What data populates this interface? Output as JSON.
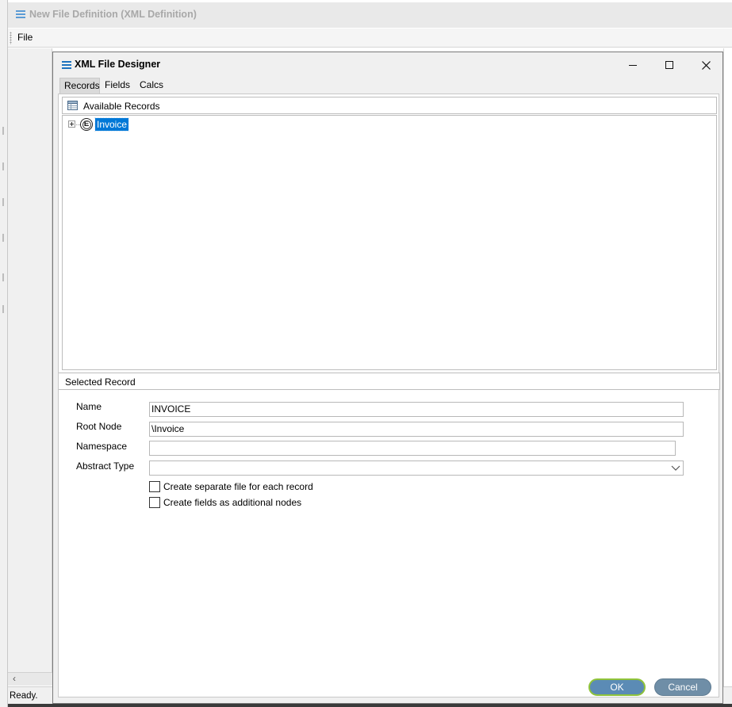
{
  "parent": {
    "title": "New File Definition (XML Definition)",
    "menu": {
      "file": "File"
    },
    "status": "Ready."
  },
  "dialog": {
    "title": "XML File Designer",
    "tabs": [
      {
        "label": "Records",
        "active": true
      },
      {
        "label": "Fields",
        "active": false
      },
      {
        "label": "Calcs",
        "active": false
      }
    ],
    "available_records": {
      "header": "Available Records",
      "items": [
        {
          "icon": "element-icon",
          "glyph": "E",
          "label": "Invoice",
          "selected": true
        }
      ]
    },
    "selected_record": {
      "header": "Selected Record",
      "name_label": "Name",
      "name_value": "INVOICE",
      "root_node_label": "Root Node",
      "root_node_value": "\\Invoice",
      "namespace_label": "Namespace",
      "namespace_value": "",
      "abstract_type_label": "Abstract Type",
      "abstract_type_value": "",
      "checkbox_separate_file": {
        "label": "Create separate file for each record",
        "checked": false
      },
      "checkbox_fields_nodes": {
        "label": "Create fields as additional nodes",
        "checked": false
      }
    },
    "buttons": {
      "ok": "OK",
      "cancel": "Cancel"
    }
  },
  "colors": {
    "selection": "#0078d7",
    "ok_button": "#5b8bb5",
    "ok_focus_ring": "#8fc33a",
    "cancel_button": "#6f8ea7",
    "title_icon": "#1e73be"
  }
}
